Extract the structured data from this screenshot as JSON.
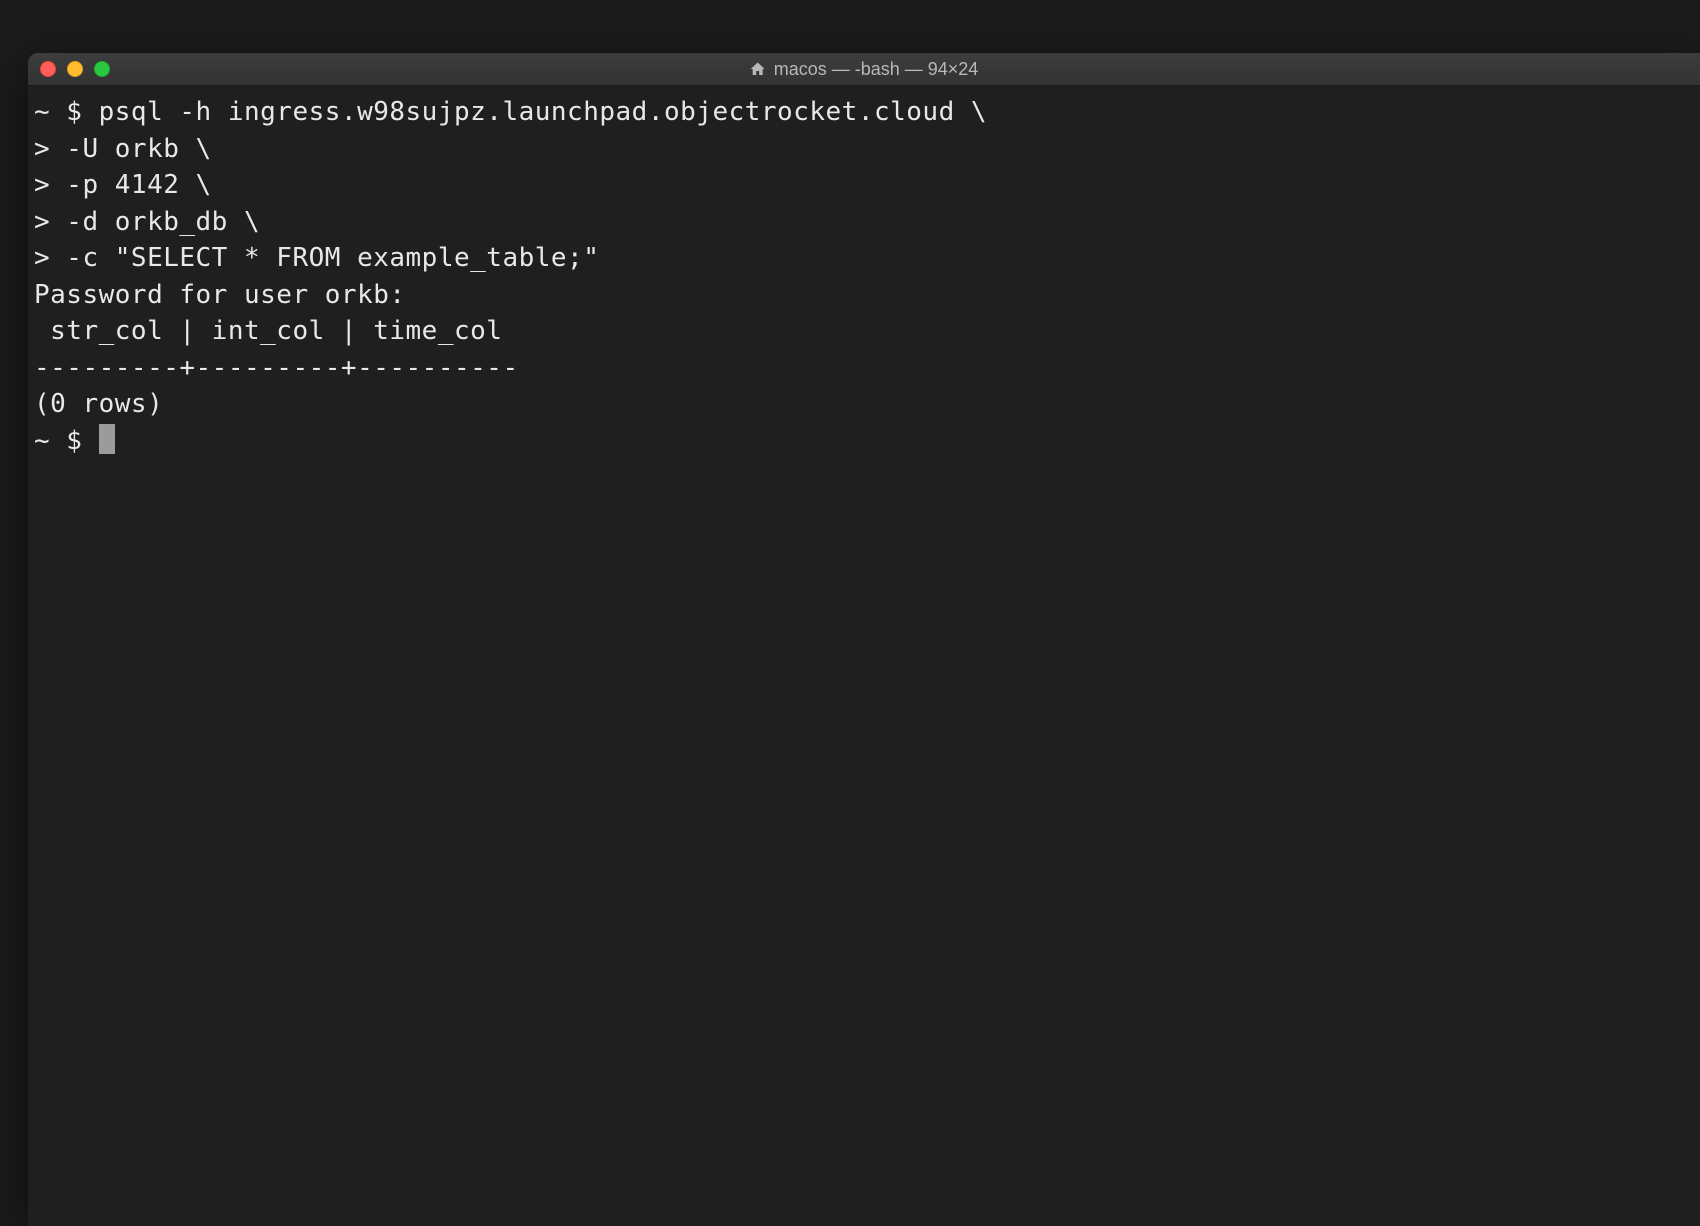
{
  "window": {
    "title": "macos — -bash — 94×24"
  },
  "terminal": {
    "lines": [
      "~ $ psql -h ingress.w98sujpz.launchpad.objectrocket.cloud \\",
      "> -U orkb \\",
      "> -p 4142 \\",
      "> -d orkb_db \\",
      "> -c \"SELECT * FROM example_table;\"",
      "Password for user orkb:",
      " str_col | int_col | time_col",
      "---------+---------+----------",
      "(0 rows)",
      "",
      "~ $ "
    ]
  }
}
